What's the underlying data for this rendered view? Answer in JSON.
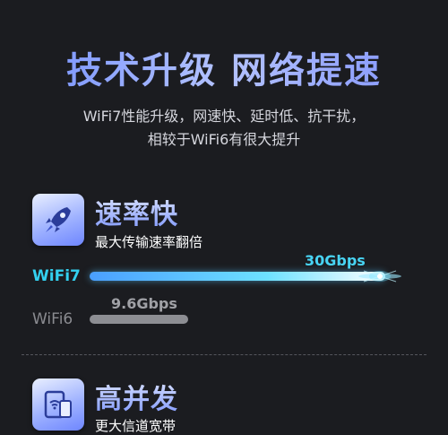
{
  "headline": "技术升级 网络提速",
  "subtitle": {
    "line1": "WiFi7性能升级，网速快、延时低、抗干扰，",
    "line2": "相较于WiFi6有很大提升"
  },
  "features": [
    {
      "icon": "rocket-icon",
      "title": "速率快",
      "subtitle": "最大传输速率翻倍"
    },
    {
      "icon": "tablet-wifi-icon",
      "title": "高并发",
      "subtitle": "更大信道宽带"
    }
  ],
  "comparison": {
    "unit": "Gbps",
    "bars": [
      {
        "label": "WiFi7",
        "value_text": "30Gbps",
        "value": 30,
        "color": "#33d0ef"
      },
      {
        "label": "WiFi6",
        "value_text": "9.6Gbps",
        "value": 9.6,
        "color": "#8d8e93"
      }
    ]
  },
  "colors": {
    "background": "#1b1c20",
    "accent_blue": "#7f98ff",
    "wifi7_cyan": "#33d0ef",
    "wifi6_gray": "#8d8e93"
  }
}
